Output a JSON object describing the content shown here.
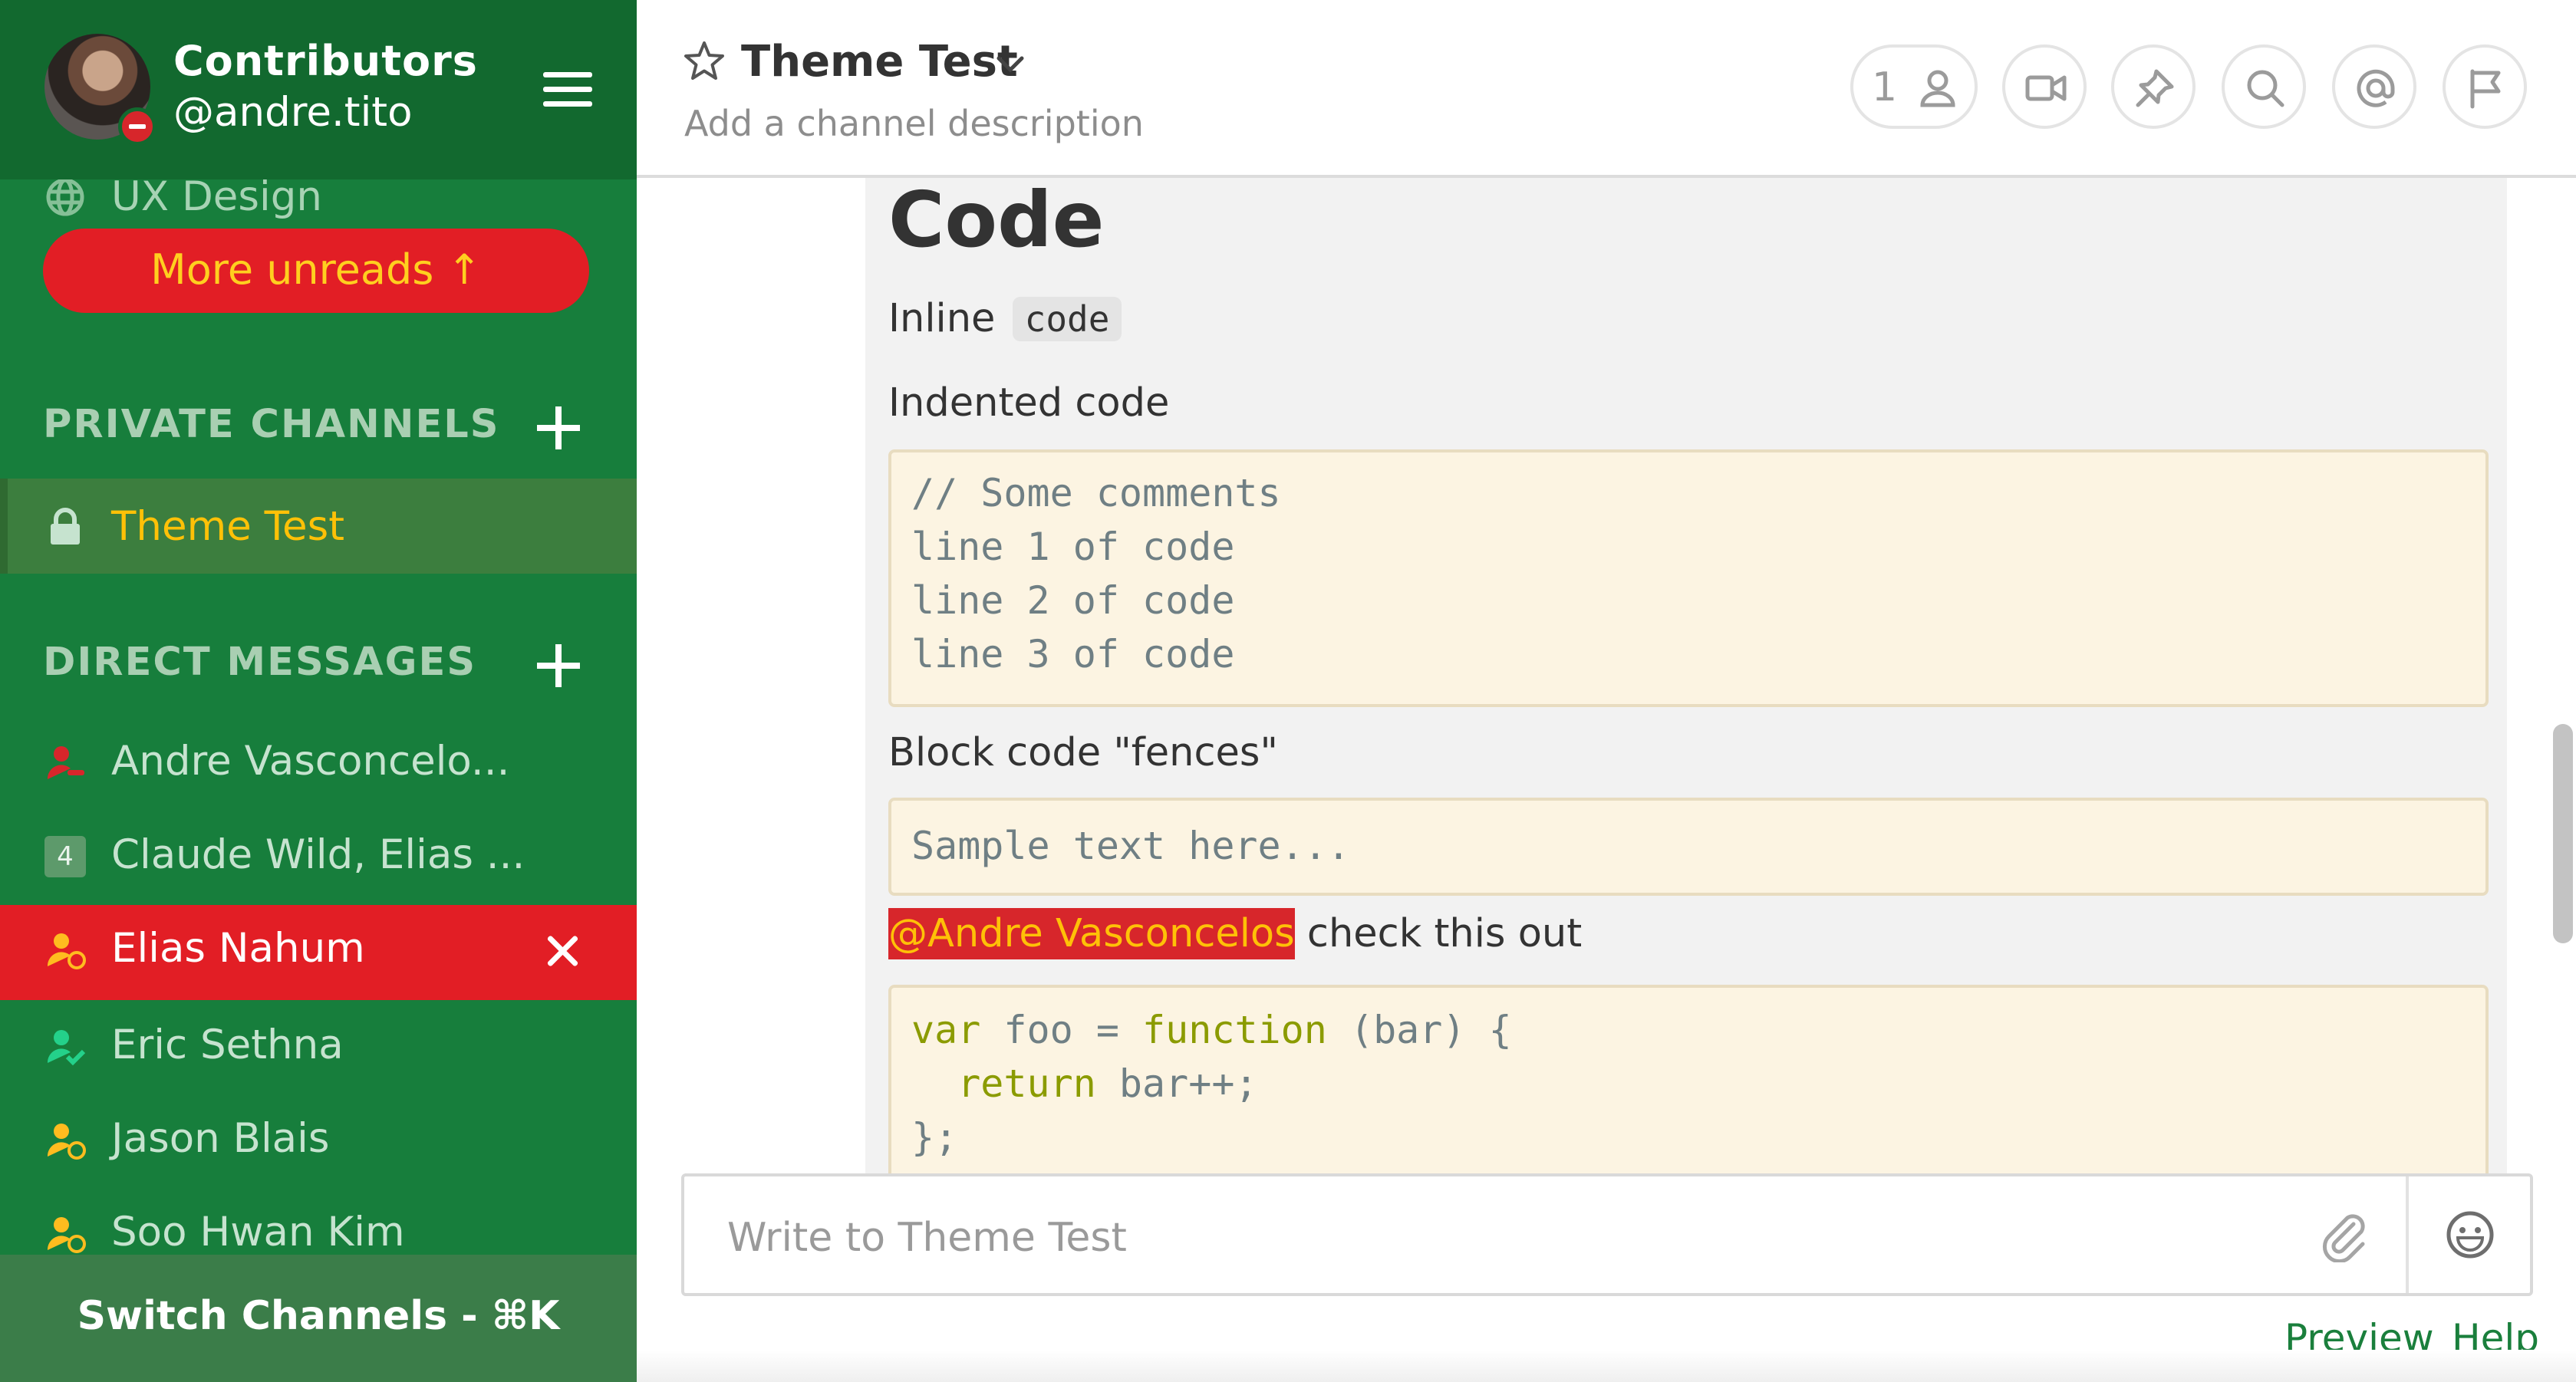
{
  "sidebar": {
    "team_name": "Contributors",
    "user_handle": "@andre.tito",
    "user_status": "do-not-disturb",
    "public_channels": [
      {
        "label": "UX Design",
        "icon": "globe-icon"
      }
    ],
    "more_unreads": "More unreads ↑",
    "private_channels_header": "PRIVATE CHANNELS",
    "private_channels": [
      {
        "label": "Theme Test",
        "icon": "lock-icon",
        "active": true
      }
    ],
    "direct_messages_header": "DIRECT MESSAGES",
    "direct_messages": [
      {
        "label": "Andre Vasconcelo...",
        "status": "dnd"
      },
      {
        "label": "Claude Wild, Elias ...",
        "group_count": "4"
      },
      {
        "label": "Elias Nahum",
        "status": "away",
        "selected": true
      },
      {
        "label": "Eric Sethna",
        "status": "online"
      },
      {
        "label": "Jason Blais",
        "status": "away"
      },
      {
        "label": "Soo Hwan Kim",
        "status": "away"
      }
    ],
    "switch_channels": "Switch Channels - ⌘K"
  },
  "header": {
    "channel_name": "Theme Test",
    "channel_description": "Add a channel description",
    "member_count": "1",
    "icons": [
      "star-icon",
      "chevron-down-icon",
      "member-icon",
      "video-icon",
      "pin-icon",
      "search-icon",
      "at-mention-icon",
      "flag-icon"
    ]
  },
  "message": {
    "heading": "Code",
    "inline_prefix": "Inline",
    "inline_code": "code",
    "indented_label": "Indented code",
    "indented_lines": [
      "// Some comments",
      "line 1 of code",
      "line 2 of code",
      "line 3 of code"
    ],
    "fences_label": "Block code \"fences\"",
    "fences_code": "Sample text here...",
    "mention": "@Andre Vasconcelos",
    "mention_suffix": " check this out",
    "js_lines": [
      {
        "kw": "var",
        "rest": " foo = ",
        "kw2": "function",
        "rest2": " (bar) {"
      },
      {
        "kw": "  return",
        "rest": " bar++;",
        "kw2": "",
        "rest2": ""
      },
      {
        "kw": "",
        "rest": "};",
        "kw2": "",
        "rest2": ""
      }
    ]
  },
  "composer": {
    "placeholder": "Write to Theme Test",
    "preview": "Preview",
    "help": "Help"
  },
  "colors": {
    "sidebar_bg": "#177e3c",
    "sidebar_header_bg": "#12692f",
    "mention_bg": "#d7262b",
    "mention_text": "#ffc107",
    "active_channel_text": "#ffc107",
    "code_bg": "#fcf4e2",
    "link": "#1a7f3c"
  }
}
